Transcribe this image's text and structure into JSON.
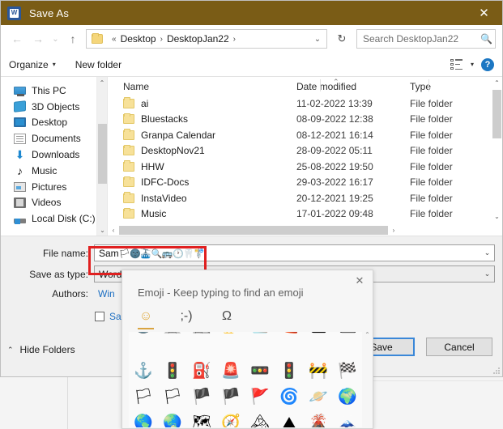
{
  "window": {
    "title": "Save As",
    "app_icon": "word-icon",
    "app_icon_letter": "W",
    "close_label": "✕",
    "titlebar_color": "#7a5c16"
  },
  "nav": {
    "back_icon": "←",
    "forward_icon": "→",
    "recent_icon": "⌄",
    "up_icon": "↑",
    "breadcrumb_root": "«",
    "breadcrumbs": [
      "Desktop",
      "DesktopJan22"
    ],
    "separator": "›",
    "dropdown_icon": "⌄",
    "refresh_icon": "↻"
  },
  "search": {
    "placeholder": "Search DesktopJan22",
    "value": "",
    "icon": "search-icon"
  },
  "toolbar": {
    "organize_label": "Organize",
    "organize_caret": "▾",
    "new_folder_label": "New folder",
    "view_caret": "▾",
    "help_label": "?"
  },
  "sidebar": {
    "items": [
      {
        "label": "This PC",
        "icon": "monitor-icon"
      },
      {
        "label": "3D Objects",
        "icon": "cube-icon"
      },
      {
        "label": "Desktop",
        "icon": "desktop-icon"
      },
      {
        "label": "Documents",
        "icon": "document-icon"
      },
      {
        "label": "Downloads",
        "icon": "download-arrow-icon"
      },
      {
        "label": "Music",
        "icon": "music-note-icon"
      },
      {
        "label": "Pictures",
        "icon": "picture-icon"
      },
      {
        "label": "Videos",
        "icon": "video-icon"
      },
      {
        "label": "Local Disk (C:)",
        "icon": "disk-icon"
      }
    ],
    "scroll_up": "⌃",
    "scroll_down": "⌄"
  },
  "filelist": {
    "columns": [
      "Name",
      "Date modified",
      "Type"
    ],
    "sort_indicator": "⌃",
    "rows": [
      {
        "name": "ai",
        "date": "11-02-2022 13:39",
        "type": "File folder"
      },
      {
        "name": "Bluestacks",
        "date": "08-09-2022 12:38",
        "type": "File folder"
      },
      {
        "name": "Granpa Calendar",
        "date": "08-12-2021 16:14",
        "type": "File folder"
      },
      {
        "name": "DesktopNov21",
        "date": "28-09-2022 05:11",
        "type": "File folder"
      },
      {
        "name": "HHW",
        "date": "25-08-2022 19:50",
        "type": "File folder"
      },
      {
        "name": "IDFC-Docs",
        "date": "29-03-2022 16:17",
        "type": "File folder"
      },
      {
        "name": "InstaVideo",
        "date": "20-12-2021 19:25",
        "type": "File folder"
      },
      {
        "name": "Music",
        "date": "17-01-2022 09:48",
        "type": "File folder"
      }
    ],
    "scroll_up": "⌃",
    "scroll_down": "⌄",
    "hscroll_left": "‹",
    "hscroll_right": "›"
  },
  "form": {
    "filename_label": "File name:",
    "filename_value": "Sam",
    "filename_emojis": "🏳🌚🚠🔍🚌🕐🦷🚏",
    "filename_chevron": "⌄",
    "savetype_label": "Save as type:",
    "savetype_value": "Word",
    "savetype_chevron": "⌄",
    "authors_label": "Authors:",
    "authors_value": "Win",
    "checkbox_label": "Sa",
    "hide_folders_label": "Hide Folders",
    "hide_folders_caret": "⌃",
    "save_button": "Save",
    "cancel_button": "Cancel"
  },
  "emoji_panel": {
    "title": "Emoji - Keep typing to find an emoji",
    "close_label": "✕",
    "tabs": [
      {
        "name": "emoji-tab",
        "glyph": "☺",
        "active": true
      },
      {
        "name": "kaomoji-tab",
        "glyph": ";-)",
        "active": false
      },
      {
        "name": "symbols-tab",
        "glyph": "Ω",
        "active": false
      }
    ],
    "scroll_up": "⌃",
    "grid_clipped_top_row": [
      "🚇",
      "🚊",
      "🚉",
      "🚁",
      "⛵",
      "🚤",
      "🛳",
      "⛴"
    ],
    "grid_rows": [
      [
        "⚓",
        "🚦",
        "⛽",
        "🚨",
        "🚥",
        "🚦",
        "🚧",
        "🏁"
      ],
      [
        "🏳",
        "🏳",
        "🏴",
        "🏴",
        "🚩",
        "🌀",
        "🪐",
        "🌍"
      ],
      [
        "🌎",
        "🌏",
        "🗺",
        "🧭",
        "🏔",
        "⛰",
        "🌋",
        "🗻"
      ]
    ]
  }
}
